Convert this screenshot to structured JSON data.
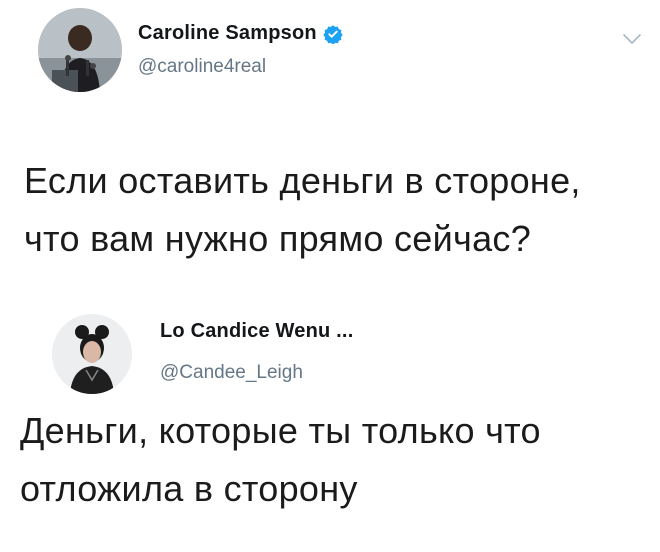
{
  "tweets": [
    {
      "author": {
        "name": "Caroline Sampson",
        "handle": "@caroline4real",
        "verified": true,
        "avatar_icon": "profile-photo-woman-at-podium"
      },
      "text_lines": [
        "Если оставить деньги в стороне,",
        "что вам нужно прямо сейчас?"
      ],
      "menu_icon": "chevron-down-icon"
    },
    {
      "author": {
        "name": "Lo Candice Wenu ...",
        "handle": "@Candee_Leigh",
        "verified": false,
        "avatar_icon": "profile-photo-woman-with-bun-hair"
      },
      "text_lines": [
        "Деньги, которые ты только что",
        "отложила в сторону"
      ]
    }
  ],
  "colors": {
    "name": "#14171a",
    "handle": "#657786",
    "verified_badge": "#1da1f2",
    "text": "#1b1b1b"
  }
}
